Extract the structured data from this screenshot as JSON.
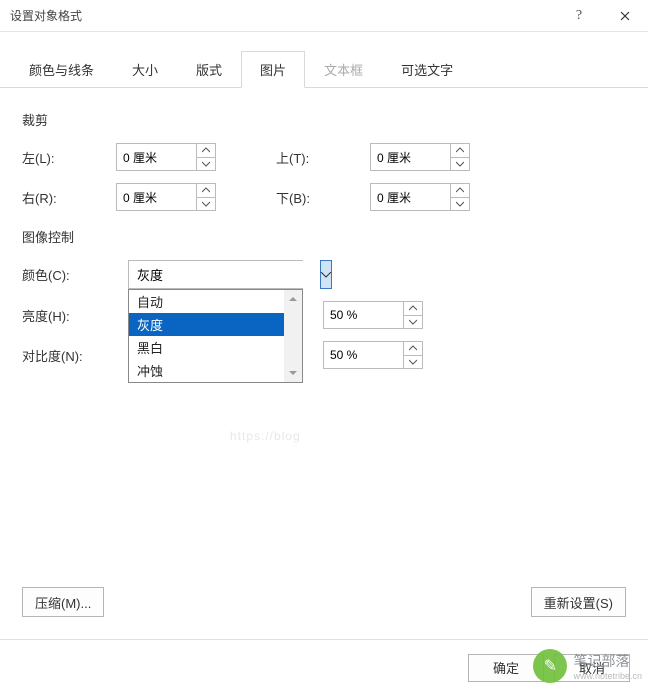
{
  "window": {
    "title": "设置对象格式",
    "help": "?",
    "close": "×"
  },
  "tabs": [
    {
      "label": "颜色与线条",
      "active": false,
      "disabled": false
    },
    {
      "label": "大小",
      "active": false,
      "disabled": false
    },
    {
      "label": "版式",
      "active": false,
      "disabled": false
    },
    {
      "label": "图片",
      "active": true,
      "disabled": false
    },
    {
      "label": "文本框",
      "active": false,
      "disabled": true
    },
    {
      "label": "可选文字",
      "active": false,
      "disabled": false
    }
  ],
  "crop": {
    "section_title": "裁剪",
    "left_label": "左(L):",
    "left_value": "0 厘米",
    "right_label": "右(R):",
    "right_value": "0 厘米",
    "top_label": "上(T):",
    "top_value": "0 厘米",
    "bottom_label": "下(B):",
    "bottom_value": "0 厘米"
  },
  "image_control": {
    "section_title": "图像控制",
    "color_label": "颜色(C):",
    "color_value": "灰度",
    "color_options": [
      "自动",
      "灰度",
      "黑白",
      "冲蚀"
    ],
    "color_selected_index": 1,
    "brightness_label": "亮度(H):",
    "brightness_value": "50 %",
    "contrast_label": "对比度(N):",
    "contrast_value": "50 %"
  },
  "buttons": {
    "compress": "压缩(M)...",
    "reset": "重新设置(S)",
    "ok": "确定",
    "cancel": "取消"
  },
  "watermark": {
    "line1": "笔记部落",
    "line2": "www.notetribe.cn",
    "faint": "https://blog"
  }
}
